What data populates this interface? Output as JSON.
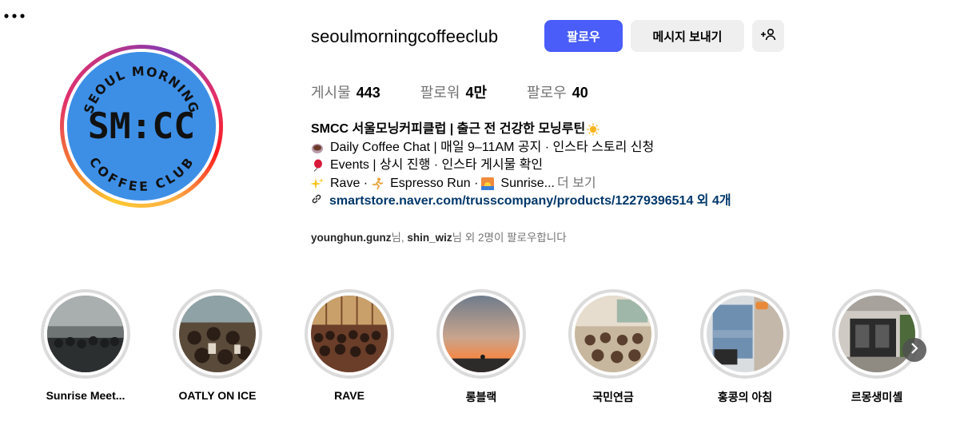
{
  "profile": {
    "username": "seoulmorningcoffeeclub",
    "avatar_text_top": "SEOUL MORNING",
    "avatar_text_main": "SM:CC",
    "avatar_text_bottom": "COFFEE CLUB",
    "avatar_color": "#3d8fe6"
  },
  "actions": {
    "follow_label": "팔로우",
    "message_label": "메시지 보내기",
    "add_user_icon": "add-user-icon",
    "more_icon": "more-options-icon"
  },
  "stats": {
    "posts_label": "게시물",
    "posts_value": "443",
    "followers_label": "팔로워",
    "followers_value": "4만",
    "following_label": "팔로우",
    "following_value": "40"
  },
  "bio": {
    "title": "SMCC 서울모닝커피클럽 | 출근 전 건강한 모닝루틴",
    "line1": "Daily Coffee Chat | 매일 9–11AM 공지 · 인스타 스토리 신청",
    "line2": "Events | 상시 진행 · 인스타 게시물 확인",
    "line3_a": "Rave · ",
    "line3_b": "Espresso Run · ",
    "line3_c": "Sunrise...",
    "more_label": "더 보기",
    "link": "smartstore.naver.com/trusscompany/products/12279396514 외 4개"
  },
  "followed_by": {
    "user1": "younghun.gunz",
    "sep1": "님, ",
    "user2": "shin_wiz",
    "suffix": "님 외 2명이 팔로우합니다"
  },
  "highlights": [
    {
      "label": "Sunrise Meet..."
    },
    {
      "label": "OATLY ON ICE"
    },
    {
      "label": "RAVE"
    },
    {
      "label": "롱블랙"
    },
    {
      "label": "국민연금"
    },
    {
      "label": "홍콩의 아침"
    },
    {
      "label": "르몽생미셸"
    }
  ],
  "colors": {
    "accent": "#4a5df9",
    "link": "#00376b",
    "muted": "#737373"
  }
}
